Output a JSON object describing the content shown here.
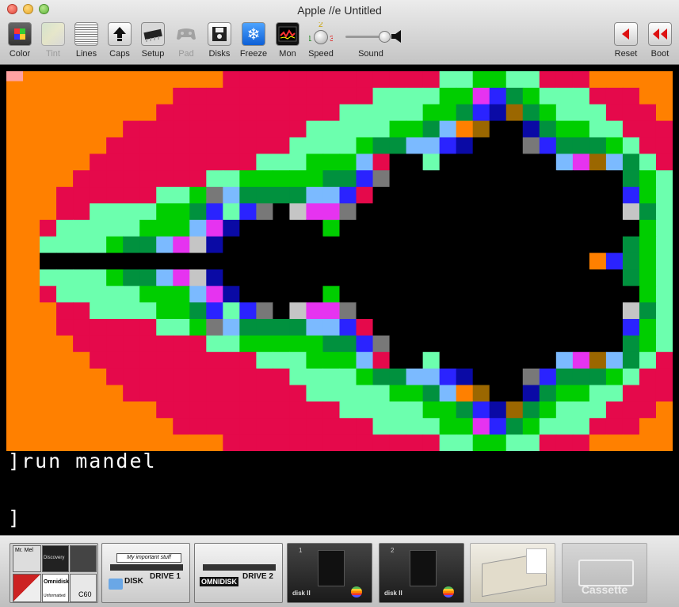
{
  "window": {
    "title": "Apple //e   Untitled"
  },
  "toolbar": {
    "items": [
      {
        "id": "color",
        "label": "Color",
        "icon": "color-palette-icon",
        "enabled": true
      },
      {
        "id": "tint",
        "label": "Tint",
        "icon": "tint-icon",
        "enabled": false
      },
      {
        "id": "lines",
        "label": "Lines",
        "icon": "scanlines-icon",
        "enabled": true
      },
      {
        "id": "caps",
        "label": "Caps",
        "icon": "caps-lock-icon",
        "enabled": true
      },
      {
        "id": "setup",
        "label": "Setup",
        "icon": "setup-chip-icon",
        "enabled": true
      },
      {
        "id": "pad",
        "label": "Pad",
        "icon": "gamepad-icon",
        "enabled": false
      },
      {
        "id": "disks",
        "label": "Disks",
        "icon": "disks-icon",
        "enabled": true
      },
      {
        "id": "freeze",
        "label": "Freeze",
        "icon": "snowflake-icon",
        "enabled": true
      },
      {
        "id": "mon",
        "label": "Mon",
        "icon": "monitor-icon",
        "enabled": true
      },
      {
        "id": "speed",
        "label": "Speed",
        "icon": "speed-dial-icon",
        "enabled": true
      },
      {
        "id": "reset",
        "label": "Reset",
        "icon": "reset-icon",
        "enabled": true
      },
      {
        "id": "boot",
        "label": "Boot",
        "icon": "boot-icon",
        "enabled": true
      }
    ],
    "speed_marks": [
      "1",
      "2",
      "3"
    ],
    "sound": {
      "label": "Sound",
      "level": 0.85
    }
  },
  "terminal": {
    "lines": [
      "]run mandel",
      "",
      "",
      "]"
    ]
  },
  "dock": {
    "cassettes": [
      "Mr. Mel",
      "Discovery",
      "Omnidisk",
      "C60",
      "Unformatted"
    ],
    "drive1": {
      "label": "My important stuff",
      "brand": "DISK",
      "name": "DRIVE 1"
    },
    "drive2": {
      "label": "",
      "brand": "OMNIDISK",
      "name": "DRIVE 2"
    },
    "disk_ii_slots": [
      {
        "slot": "1",
        "brand": "disk II"
      },
      {
        "slot": "2",
        "brand": "disk II"
      }
    ],
    "cassette_deck": {
      "label": "Cassette"
    }
  },
  "colors": {
    "orange": "#ff8000",
    "red": "#e5094b",
    "aqua": "#6cffae",
    "green": "#00ce00",
    "dkgreen": "#01913e",
    "blue": "#2a23ff",
    "ltblue": "#7bbaff",
    "magenta": "#e633f0",
    "brown": "#9b6700",
    "gray": "#787878",
    "ltgray": "#c5c5c5",
    "navy": "#0a0aa5",
    "pink": "#ffa2a2",
    "black": "#000000",
    "white": "#ffffff"
  }
}
